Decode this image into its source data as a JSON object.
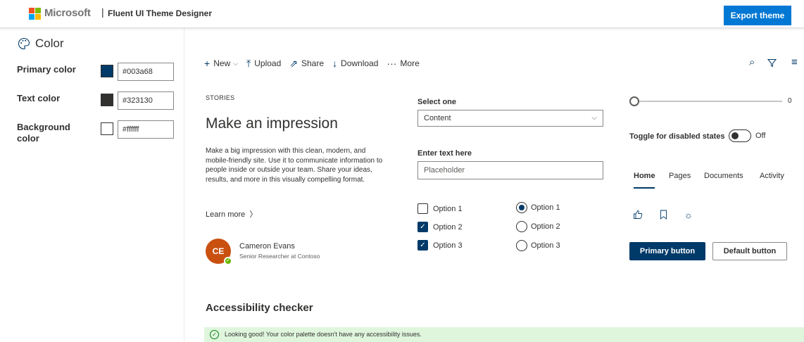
{
  "header": {
    "brand": "Microsoft",
    "separator": "|",
    "app_title": "Fluent UI Theme Designer",
    "export_label": "Export theme",
    "logo_colors": [
      "#f25022",
      "#7fba00",
      "#00a4ef",
      "#ffb900"
    ]
  },
  "left": {
    "heading": "Color",
    "heading_icon": "palette-icon",
    "rows": [
      {
        "label": "Primary color",
        "swatch": "#003a68",
        "value": "#003a68"
      },
      {
        "label": "Text color",
        "swatch": "#323130",
        "value": "#323130"
      },
      {
        "label": "Background color",
        "swatch": "#ffffff",
        "value": "#ffffff"
      }
    ]
  },
  "commandbar": {
    "items": [
      {
        "label": "New",
        "icon": "plus-icon"
      },
      {
        "label": "Upload",
        "icon": "upload-icon"
      },
      {
        "label": "Share",
        "icon": "share-icon"
      },
      {
        "label": "Download",
        "icon": "download-icon"
      },
      {
        "label": "More",
        "icon": "more-icon"
      }
    ],
    "right_icons": [
      "search-icon",
      "filter-icon",
      "menu-icon"
    ]
  },
  "story": {
    "eyebrow": "STORIES",
    "title": "Make an impression",
    "body": "Make a big impression with this clean, modern, and mobile-friendly site. Use it to communicate information to people inside or outside your team. Share your ideas, results, and more in this visually compelling format.",
    "link": "Learn more",
    "person": {
      "initials": "CE",
      "name": "Cameron Evans",
      "title": "Senior Researcher at Contoso"
    }
  },
  "form": {
    "dropdown_label": "Select one",
    "dropdown_value": "Content",
    "text_label": "Enter text here",
    "text_placeholder": "Placeholder",
    "checkboxes": [
      {
        "label": "Option 1",
        "checked": false
      },
      {
        "label": "Option 2",
        "checked": true
      },
      {
        "label": "Option 3",
        "checked": true
      }
    ],
    "radios": [
      {
        "label": "Option 1",
        "selected": true
      },
      {
        "label": "Option 2",
        "selected": false
      },
      {
        "label": "Option 3",
        "selected": false
      }
    ]
  },
  "controls": {
    "slider_value": "0",
    "toggle_label": "Toggle for disabled states",
    "toggle_state": "Off",
    "pivots": [
      "Home",
      "Pages",
      "Documents",
      "Activity"
    ],
    "icon_buttons": [
      "like-icon",
      "bookmark-icon",
      "brightness-icon"
    ],
    "primary_button": "Primary button",
    "default_button": "Default button"
  },
  "accessibility": {
    "heading": "Accessibility checker",
    "message": "Looking good! Your color palette doesn't have any accessibility issues."
  },
  "colors": {
    "primary": "#003a68",
    "text": "#323130",
    "accent_header": "#0078d4",
    "success_bg": "#dff6dd",
    "avatar": "#ca5010"
  }
}
